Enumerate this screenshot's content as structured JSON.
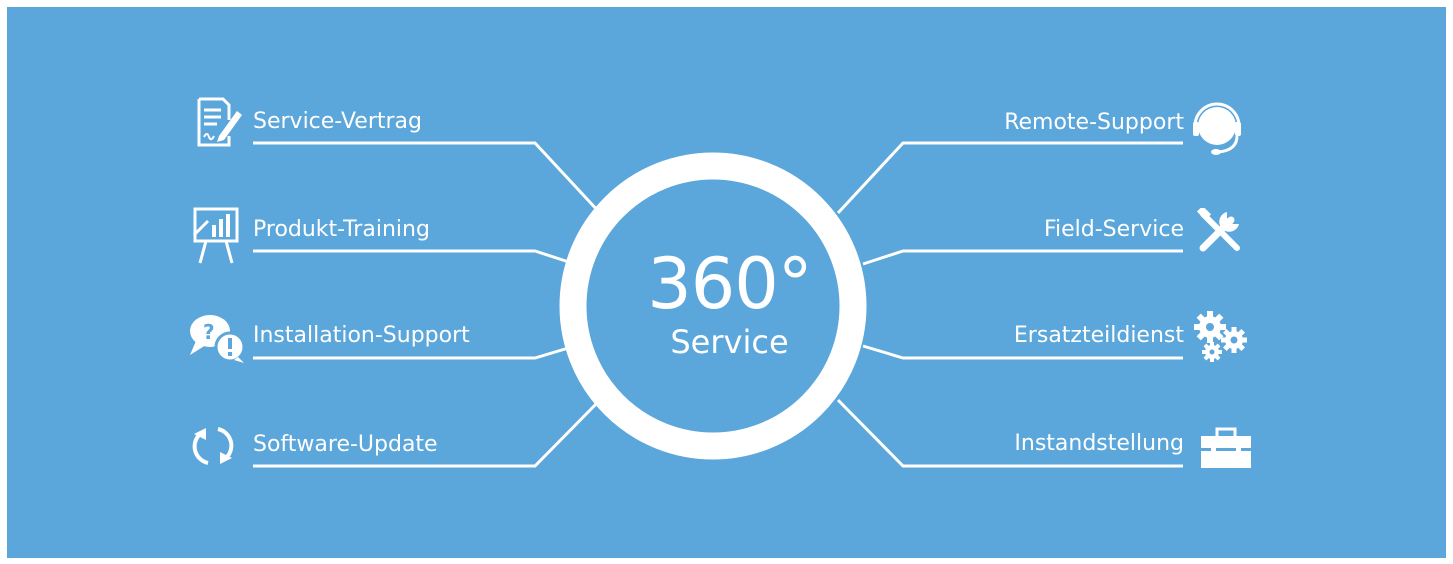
{
  "center": {
    "number": "360°",
    "word": "Service"
  },
  "left_items": [
    {
      "label": "Service-Vertrag",
      "icon": "contract-icon"
    },
    {
      "label": "Produkt-Training",
      "icon": "presentation-board-icon"
    },
    {
      "label": "Installation-Support",
      "icon": "question-bubble-icon"
    },
    {
      "label": "Software-Update",
      "icon": "refresh-icon"
    }
  ],
  "right_items": [
    {
      "label": "Remote-Support",
      "icon": "headset-icon"
    },
    {
      "label": "Field-Service",
      "icon": "tools-icon"
    },
    {
      "label": "Ersatzteildienst",
      "icon": "gears-icon"
    },
    {
      "label": "Instandstellung",
      "icon": "toolbox-icon"
    }
  ],
  "colors": {
    "background": "#5ba6da",
    "foreground": "#ffffff"
  }
}
